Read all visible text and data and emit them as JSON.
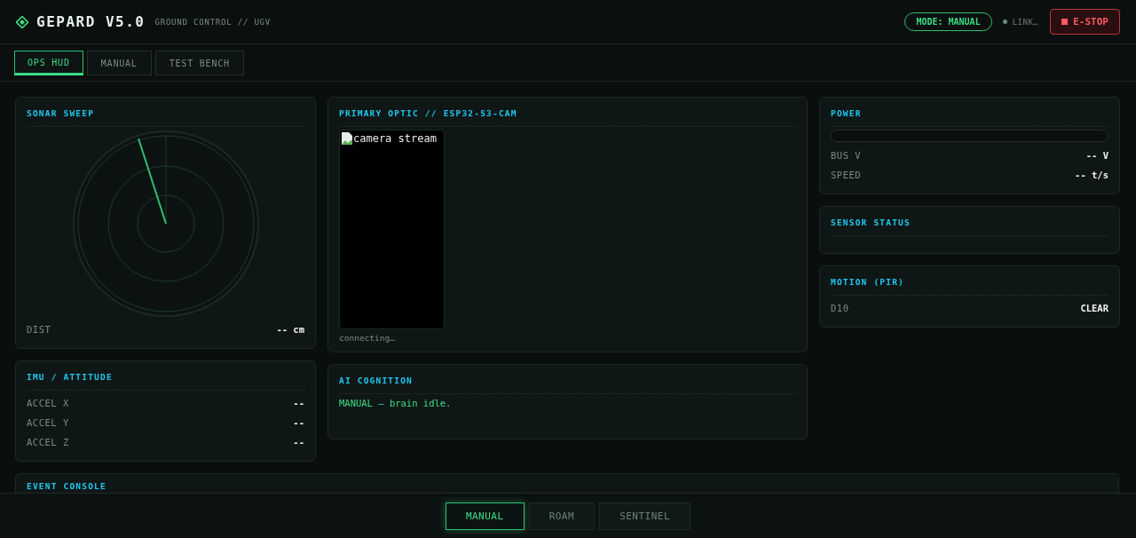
{
  "header": {
    "title": "GEPARD V5.0",
    "subtitle": "GROUND CONTROL // UGV",
    "mode_badge": "MODE: MANUAL",
    "link_status": "LINK…",
    "estop_button": "E-STOP"
  },
  "tabs": [
    {
      "label": "OPS HUD",
      "selected": true
    },
    {
      "label": "MANUAL",
      "selected": false
    },
    {
      "label": "TEST BENCH",
      "selected": false
    }
  ],
  "columns": [
    {
      "panels": [
        {
          "kind": "sonar",
          "title": "SONAR SWEEP",
          "readings": [
            {
              "label": "DIST",
              "value": "-- cm"
            }
          ]
        },
        {
          "kind": "readings",
          "title": "IMU / ATTITUDE",
          "readings": [
            {
              "label": "ACCEL X",
              "value": "--"
            },
            {
              "label": "ACCEL Y",
              "value": "--"
            },
            {
              "label": "ACCEL Z",
              "value": "--"
            }
          ]
        }
      ]
    },
    {
      "panels": [
        {
          "kind": "camera",
          "title": "PRIMARY OPTIC // ESP32-S3-CAM",
          "stream_alt": "camera stream",
          "status": "connecting…"
        },
        {
          "kind": "text",
          "title": "AI COGNITION",
          "message": "MANUAL — brain idle."
        }
      ]
    },
    {
      "panels": [
        {
          "kind": "power",
          "title": "POWER",
          "level": 0,
          "readings": [
            {
              "label": "BUS V",
              "value": "-- V"
            },
            {
              "label": "SPEED",
              "value": "-- t/s"
            }
          ]
        },
        {
          "kind": "empty",
          "title": "SENSOR STATUS"
        },
        {
          "kind": "readings",
          "title": "MOTION (PIR)",
          "readings": [
            {
              "label": "D10",
              "value": "CLEAR"
            }
          ]
        }
      ]
    }
  ],
  "event_console": {
    "title": "EVENT CONSOLE"
  },
  "modes": [
    {
      "label": "MANUAL",
      "selected": true
    },
    {
      "label": "ROAM",
      "selected": false
    },
    {
      "label": "SENTINEL",
      "selected": false
    }
  ]
}
